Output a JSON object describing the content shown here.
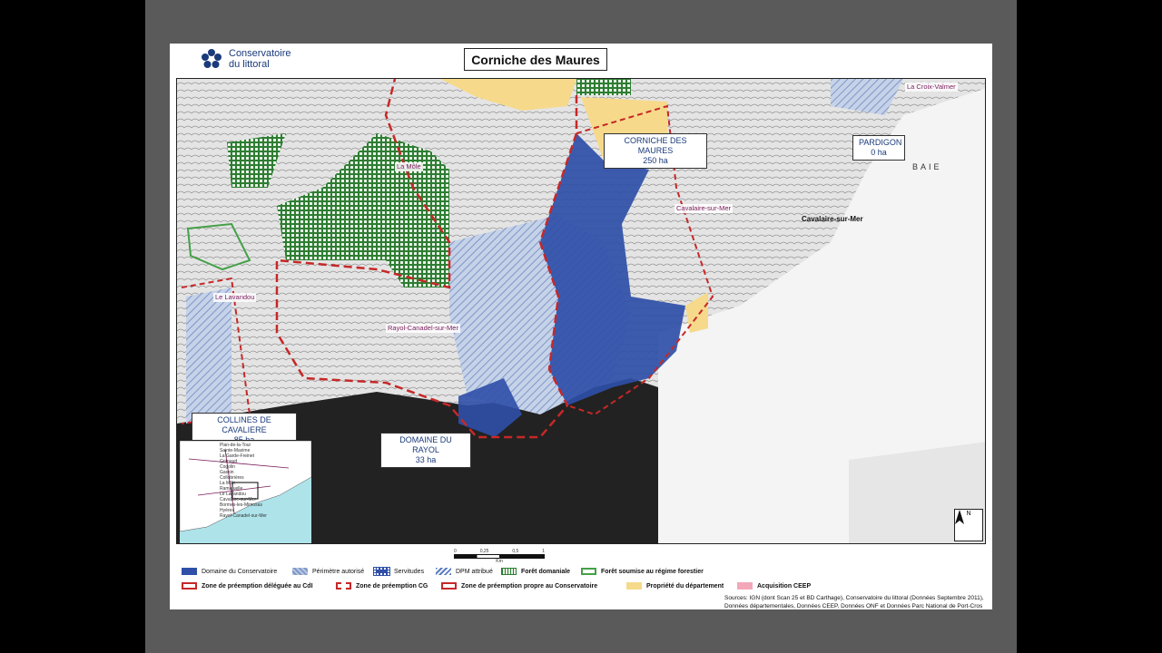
{
  "header": {
    "org_line1": "Conservatoire",
    "org_line2": "du littoral",
    "title": "Corniche des Maures"
  },
  "map": {
    "sites": [
      {
        "name": "CORNICHE DES MAURES",
        "area": "250 ha"
      },
      {
        "name": "PARDIGON",
        "area": "0 ha"
      },
      {
        "name": "COLLINES DE CAVALIERE",
        "area": "85 ha"
      },
      {
        "name": "DOMAINE DU RAYOL",
        "area": "33 ha"
      }
    ],
    "towns": [
      "La Croix-Valmer",
      "La Môle",
      "Cavalaire-sur-Mer",
      "Le Lavandou",
      "Rayol-Canadel-sur-Mer"
    ],
    "map_text": {
      "baie": "BAIE",
      "cavalaire": "Cavalaire-sur-Mer"
    },
    "inset_labels": [
      "Plan-de-la-Tour",
      "Sainte-Maxime",
      "La Garde-Freinet",
      "Grimaud",
      "Cogolin",
      "Gassin",
      "Collobrières",
      "La Môle",
      "Ramatuelle",
      "Le Lavandou",
      "Cavalaire-sur-Mer",
      "Bormes-les-Mimosas",
      "Hyères",
      "Rayol-Canadel-sur-Mer"
    ],
    "north_label": "N",
    "scale": {
      "ticks": [
        "0",
        "0,25",
        "0,5",
        "1"
      ],
      "unit": "Km"
    }
  },
  "legend": {
    "items": [
      {
        "label": "Domaine du Conservatoire",
        "color": "#2f4fa8"
      },
      {
        "label": "Périmètre autorisé",
        "color": "#b9c8e2"
      },
      {
        "label": "Servitudes",
        "color": "#2f4fa8"
      },
      {
        "label": "DPM attribué",
        "color": "#5a7cc2"
      },
      {
        "label": "Forêt domaniale",
        "color": "#2e7d32"
      },
      {
        "label": "Forêt soumise au régime forestier",
        "color": "#43a047"
      },
      {
        "label": "Acquisition CEEP",
        "color": "#f4a7b9"
      },
      {
        "label": "Zone de préemption déléguée au CdI",
        "color": "#c62828"
      },
      {
        "label": "Zone de préemption CG",
        "color": "#c62828"
      },
      {
        "label": "Zone de préemption propre au Conservatoire",
        "color": "#c62828"
      },
      {
        "label": "Propriété du département",
        "color": "#f6d98a"
      }
    ]
  },
  "sources": {
    "line1": "Sources: IGN (dont Scan 25 et BD Carthage), Conservatoire du littoral (Données Septembre 2011),",
    "line2": "Données départementales, Données CEEP, Données ONF et Données Parc National de Port-Cros"
  }
}
